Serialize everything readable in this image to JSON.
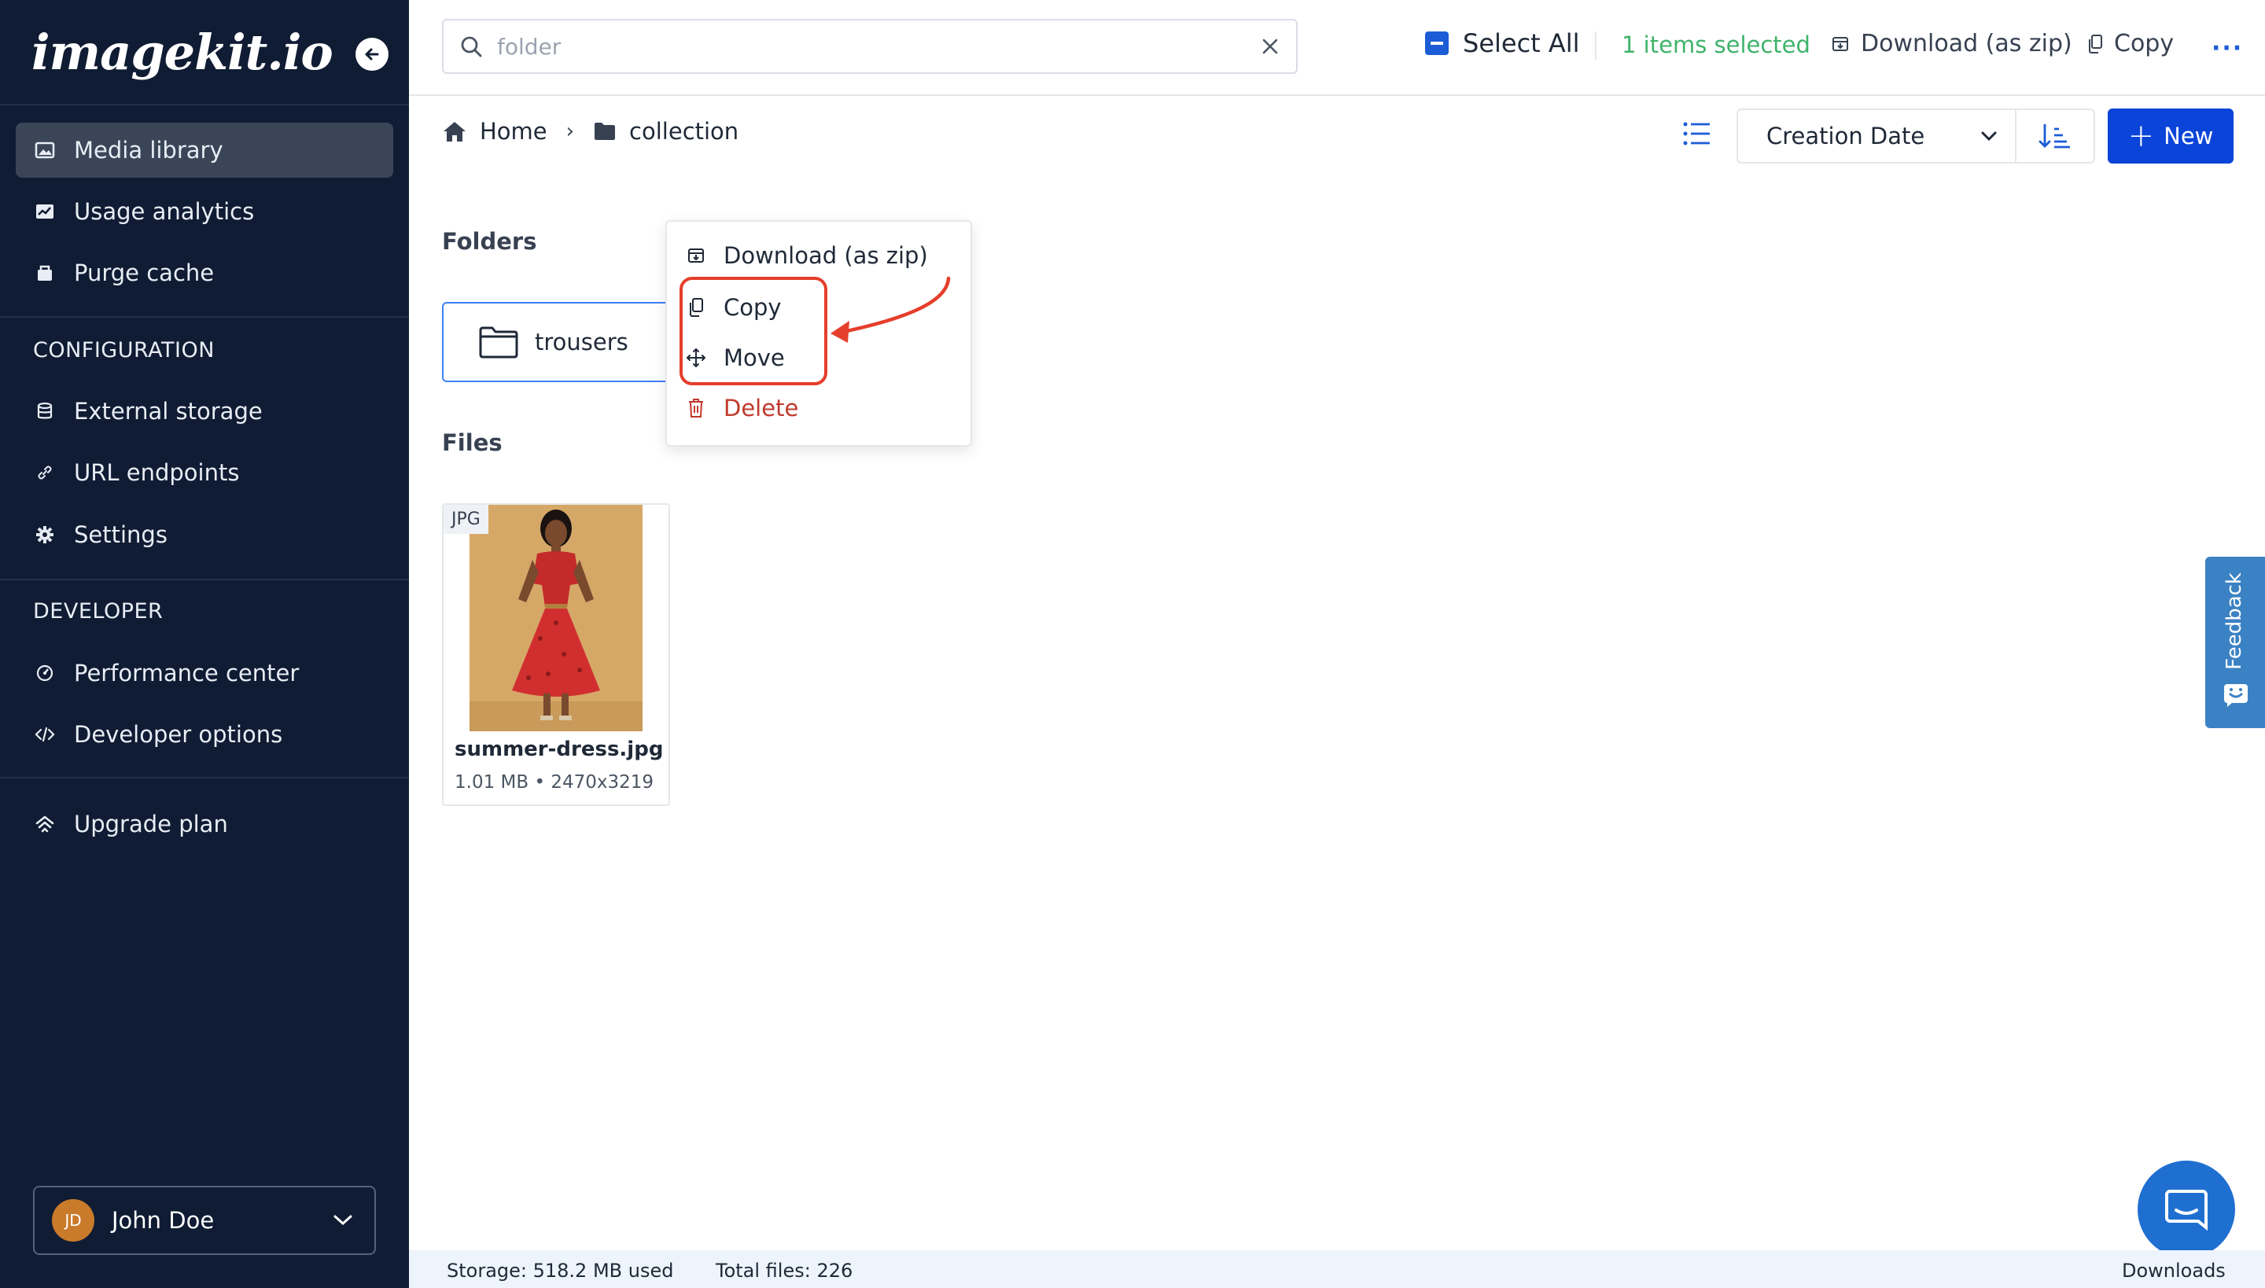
{
  "app": {
    "logo": "imagekit.io"
  },
  "sidebar": {
    "items": [
      {
        "label": "Media library",
        "icon": "image-icon"
      },
      {
        "label": "Usage analytics",
        "icon": "chart-icon"
      },
      {
        "label": "Purge cache",
        "icon": "cache-icon"
      }
    ],
    "config_heading": "CONFIGURATION",
    "config_items": [
      {
        "label": "External storage",
        "icon": "database-icon"
      },
      {
        "label": "URL endpoints",
        "icon": "link-icon"
      },
      {
        "label": "Settings",
        "icon": "gear-icon"
      }
    ],
    "developer_heading": "DEVELOPER",
    "developer_items": [
      {
        "label": "Performance center",
        "icon": "gauge-icon"
      },
      {
        "label": "Developer options",
        "icon": "code-icon"
      }
    ],
    "upgrade": {
      "label": "Upgrade plan",
      "icon": "upgrade-icon"
    },
    "user": {
      "initials": "JD",
      "name": "John Doe"
    }
  },
  "topbar": {
    "search_placeholder": "folder",
    "select_all": "Select All",
    "selected_count": "1 items selected",
    "download_zip": "Download (as zip)",
    "copy": "Copy"
  },
  "breadcrumb": {
    "home": "Home",
    "current": "collection"
  },
  "toolbar": {
    "sort_by": "Creation Date",
    "new": "New"
  },
  "folders": {
    "title": "Folders",
    "items": [
      {
        "name": "trousers"
      }
    ]
  },
  "files": {
    "title": "Files",
    "items": [
      {
        "type": "JPG",
        "name": "summer-dress.jpg",
        "meta": "1.01 MB • 2470x3219"
      }
    ]
  },
  "context_menu": {
    "download": "Download (as zip)",
    "copy": "Copy",
    "move": "Move",
    "delete": "Delete"
  },
  "feedback": {
    "label": "Feedback"
  },
  "statusbar": {
    "storage": "Storage: 518.2 MB used",
    "total_files": "Total files: 226",
    "downloads": "Downloads"
  },
  "colors": {
    "sidebar_bg": "#0f1c33",
    "accent": "#0b44d8",
    "success": "#3fb36b",
    "danger": "#c0392b",
    "highlight": "#e53e2b"
  }
}
